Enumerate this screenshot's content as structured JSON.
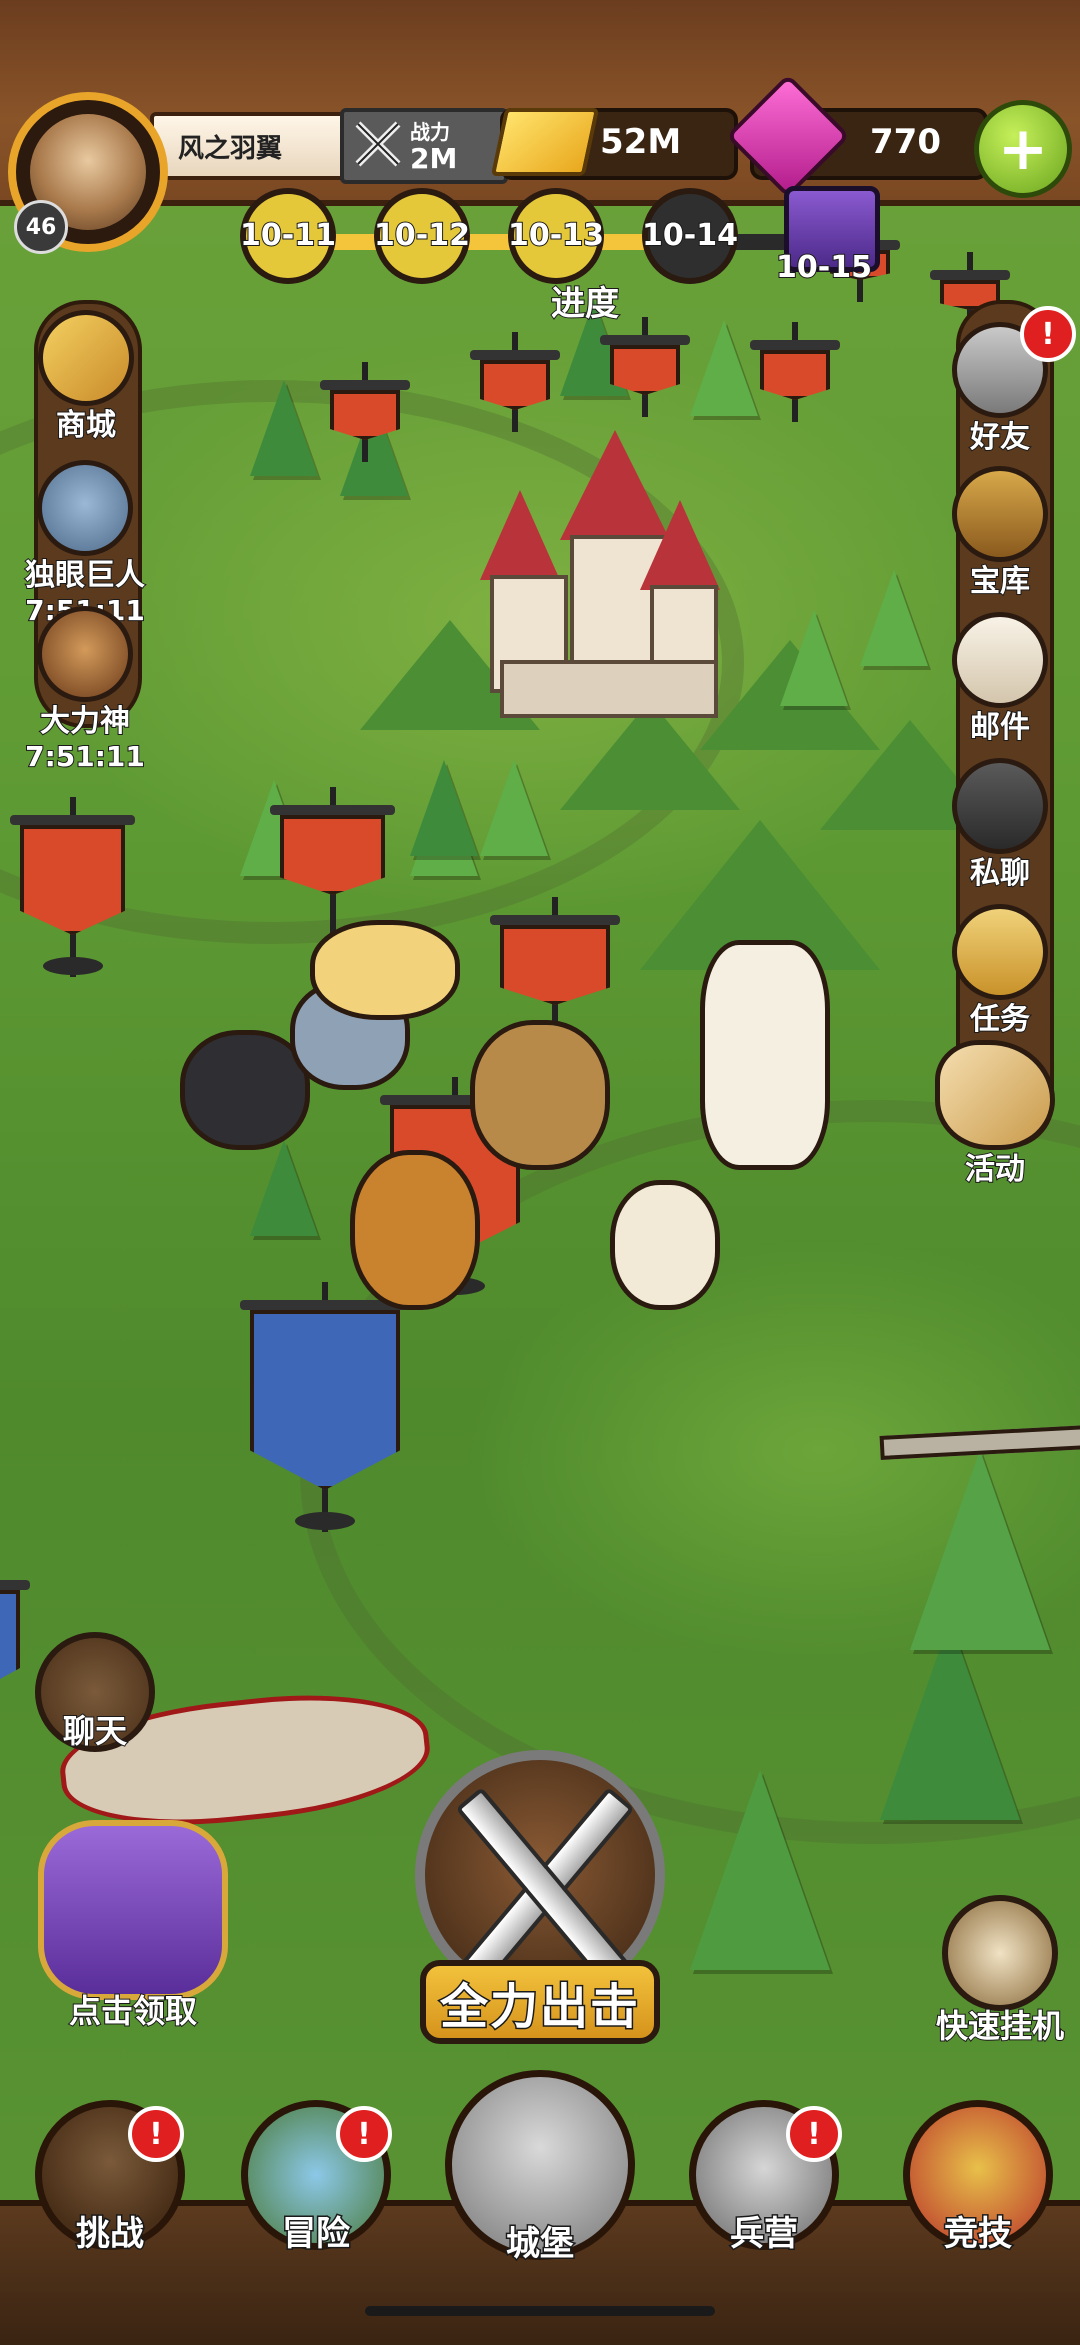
{
  "player": {
    "name": "风之羽翼",
    "level": "46",
    "power_label": "战力",
    "power_value": "2M"
  },
  "currency": {
    "gold": "52M",
    "gems": "770",
    "add_label": "+"
  },
  "progress": {
    "title": "进度",
    "fill_fraction": 0.72,
    "stages": [
      {
        "label": "10-11",
        "state": "cleared"
      },
      {
        "label": "10-12",
        "state": "cleared"
      },
      {
        "label": "10-13",
        "state": "current"
      },
      {
        "label": "10-14",
        "state": "locked"
      },
      {
        "label": "10-15",
        "state": "reward-chest"
      }
    ]
  },
  "left_menu": {
    "shop": "商城",
    "cyclops": {
      "label": "独眼巨人",
      "timer": "7:51:11"
    },
    "hercules": {
      "label": "大力神",
      "timer": "7:51:11"
    }
  },
  "right_menu": {
    "friends": "好友",
    "vault": "宝库",
    "mail": "邮件",
    "private_chat": "私聊",
    "tasks": "任务",
    "events": "活动",
    "alert_symbol": "!"
  },
  "actions": {
    "chat": "聊天",
    "claim": "点击领取",
    "fast_idle": "快速挂机",
    "attack": "全力出击"
  },
  "bottom_nav": [
    {
      "label": "挑战",
      "icon": "crossed-swords-icon",
      "alert": true
    },
    {
      "label": "冒险",
      "icon": "island-icon",
      "alert": true
    },
    {
      "label": "城堡",
      "icon": "castle-icon",
      "alert": false,
      "active": true
    },
    {
      "label": "兵营",
      "icon": "knight-helmet-icon",
      "alert": true
    },
    {
      "label": "竞技",
      "icon": "arena-crest-icon",
      "alert": false
    }
  ],
  "colors": {
    "banner_red": "#d94a2a",
    "banner_blue": "#3f67b8",
    "gold_accent": "#f4c53a",
    "alert_red": "#e02020",
    "grass": "#5e9a33"
  }
}
